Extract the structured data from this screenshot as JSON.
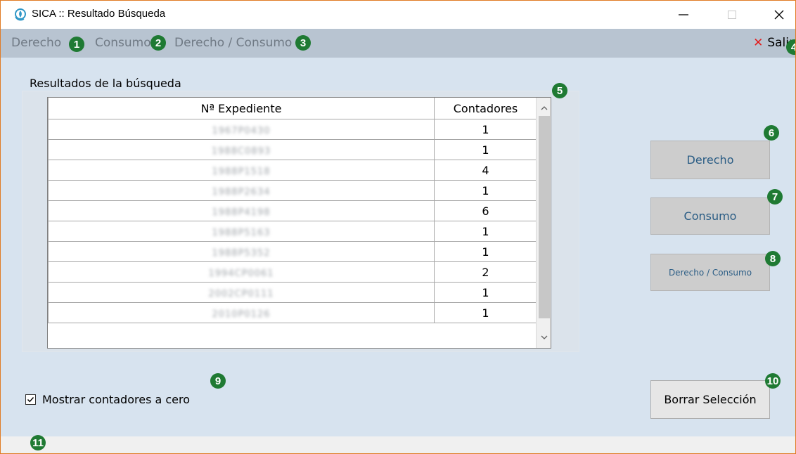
{
  "window": {
    "title": "SICA :: Resultado Búsqueda"
  },
  "menu": [
    {
      "label": "Derecho"
    },
    {
      "label": "Consumo"
    },
    {
      "label": "Derecho / Consumo"
    }
  ],
  "exit": {
    "label": "Salir"
  },
  "results": {
    "group_label": "Resultados de la búsqueda",
    "columns": [
      "Nª Expediente",
      "Contadores"
    ],
    "rows": [
      {
        "expediente": "1967P0430",
        "contadores": "1"
      },
      {
        "expediente": "1988C0893",
        "contadores": "1"
      },
      {
        "expediente": "1988P1518",
        "contadores": "4"
      },
      {
        "expediente": "1988P2634",
        "contadores": "1"
      },
      {
        "expediente": "1988P4198",
        "contadores": "6"
      },
      {
        "expediente": "1988P5163",
        "contadores": "1"
      },
      {
        "expediente": "1988P5352",
        "contadores": "1"
      },
      {
        "expediente": "1994CP0061",
        "contadores": "2"
      },
      {
        "expediente": "2002CP0111",
        "contadores": "1"
      },
      {
        "expediente": "2010P0126",
        "contadores": "1"
      }
    ]
  },
  "buttons": {
    "derecho": "Derecho",
    "consumo": "Consumo",
    "derecho_consumo": "Derecho / Consumo",
    "borrar": "Borrar Selección"
  },
  "show_zero": {
    "label": "Mostrar contadores a cero",
    "checked": true
  },
  "badges": [
    "1",
    "2",
    "3",
    "4",
    "5",
    "6",
    "7",
    "8",
    "9",
    "10",
    "11"
  ],
  "colors": {
    "accent_window_border": "#e07b24",
    "badge": "#1f7a33",
    "exit_x": "#e21d1d"
  }
}
